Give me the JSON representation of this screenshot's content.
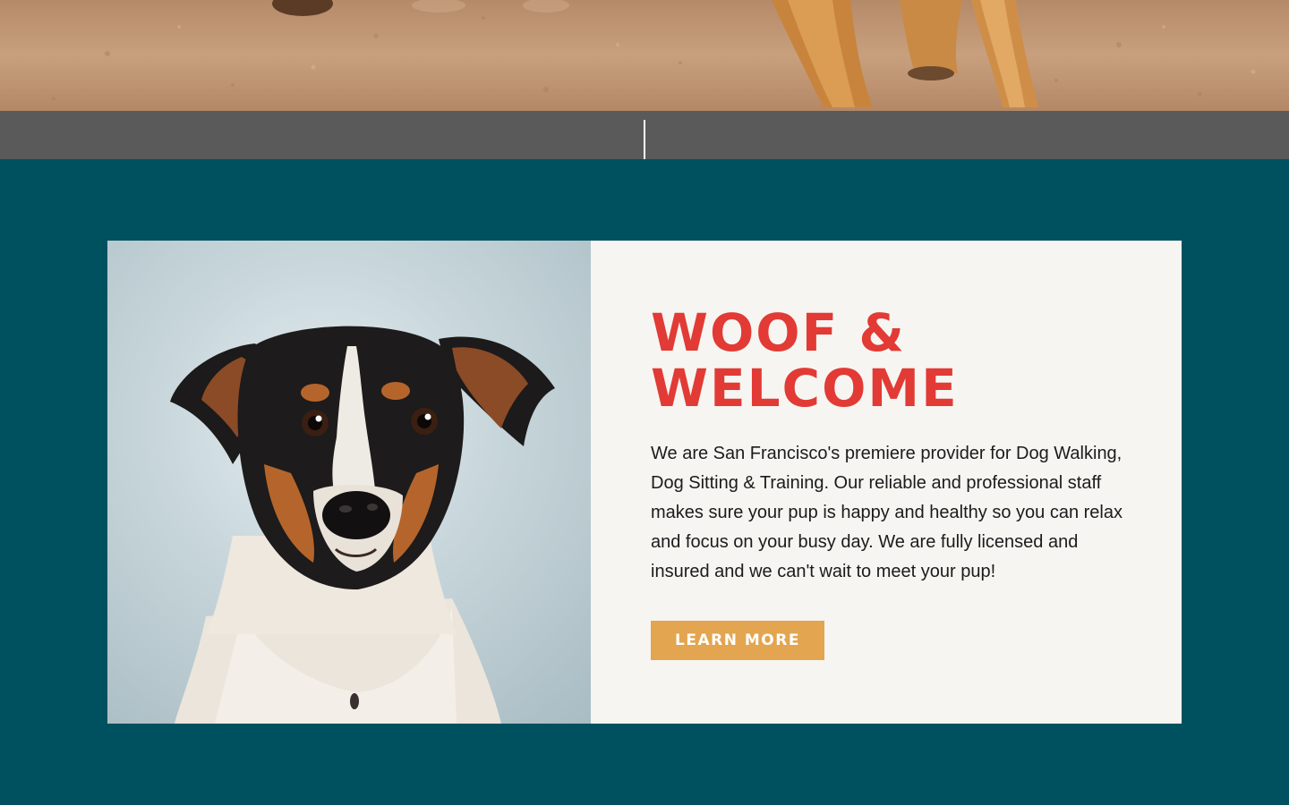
{
  "hero": {
    "image_description_icon": "dog-walk-photo"
  },
  "welcome": {
    "title": "WOOF & WELCOME",
    "body": "We are San Francisco's premiere provider for Dog Walking, Dog Sitting & Training. Our reliable and professional staff makes sure your pup is happy and healthy so you can relax and focus on your busy day. We are fully licensed and insured and we can't wait to meet your pup!",
    "button_label": "LEARN MORE"
  },
  "colors": {
    "teal_background": "#00515f",
    "divider_bar": "#5a5a5a",
    "card_background": "#f6f5f1",
    "title_red": "#e23a35",
    "button_orange": "#e3a54f"
  }
}
